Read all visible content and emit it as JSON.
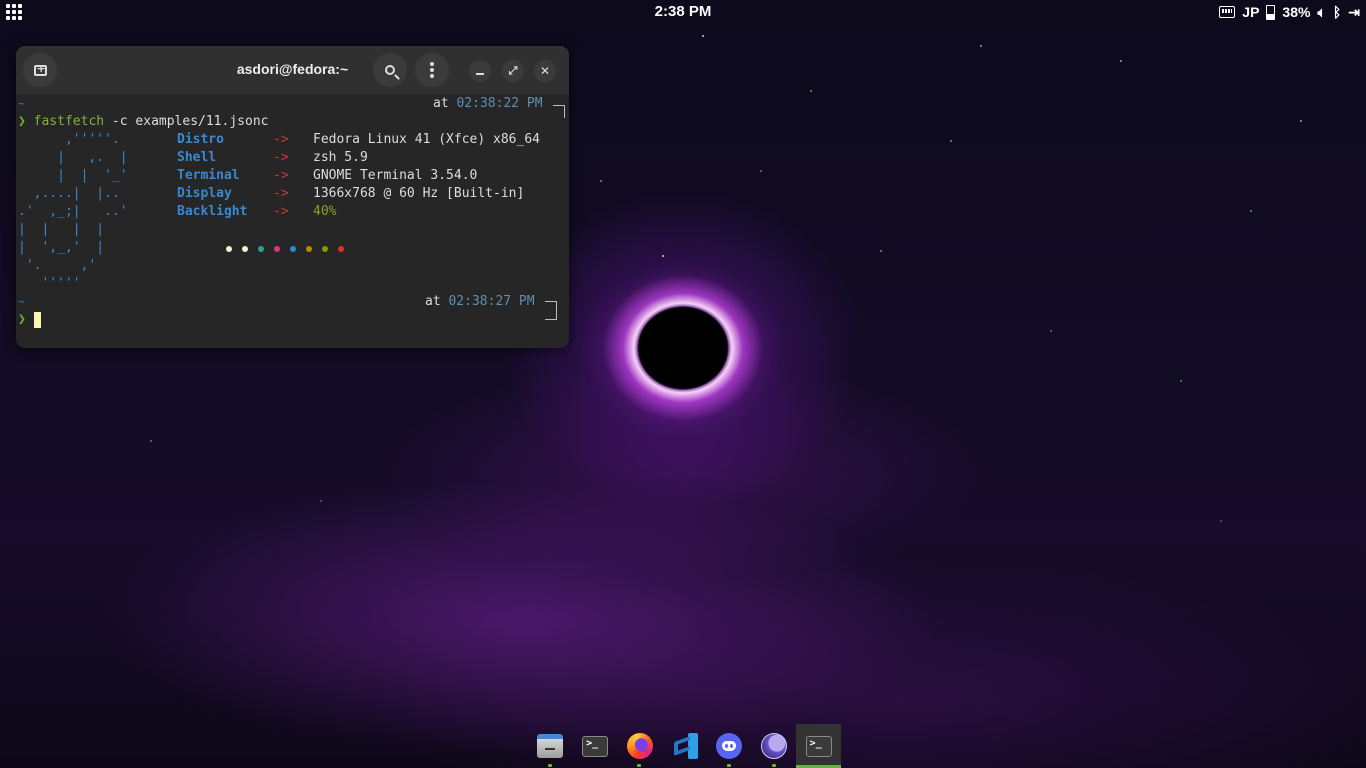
{
  "topbar": {
    "clock": "2:38 PM",
    "input_method": "JP",
    "battery_percent": "38%",
    "icons": [
      "apps-grid-icon",
      "keyboard-icon",
      "battery-icon",
      "volume-icon",
      "bluetooth-icon",
      "logout-icon"
    ]
  },
  "terminal": {
    "title": "asdori@fedora:~",
    "lines": {
      "tilde1": "~",
      "at1": "at ",
      "ts1": "02:38:22 PM",
      "prompt_char": "❯",
      "command": "fastfetch",
      "command_args": " -c examples/11.jsonc",
      "tilde2": "~",
      "at2": "at ",
      "ts2": "02:38:27 PM"
    },
    "logo": [
      "      ,'''''.",
      "     |   ,.  |",
      "     |  |  '_'",
      "  ,....|  |..",
      ".'  ,_;|   ..'",
      "|  |   |  |",
      "|  ',_,'  |",
      " '.     ,'",
      "   '''''"
    ],
    "info": [
      {
        "key": "Distro",
        "arrow": "->",
        "value": "Fedora Linux 41 (Xfce) x86_64"
      },
      {
        "key": "Shell",
        "arrow": "->",
        "value": "zsh 5.9"
      },
      {
        "key": "Terminal",
        "arrow": "->",
        "value": "GNOME Terminal 3.54.0"
      },
      {
        "key": "Display",
        "arrow": "->",
        "value": "1366x768 @ 60 Hz [Built-in]"
      },
      {
        "key": "Backlight",
        "arrow": "->",
        "value": "40%"
      }
    ],
    "color_dots": [
      "#f5f0c8",
      "#f5f0c8",
      "#2aa198",
      "#d33682",
      "#268bd2",
      "#b58900",
      "#859900",
      "#dc322f"
    ]
  },
  "dock": {
    "apps": [
      "Files",
      "Terminal",
      "Firefox",
      "Visual Studio Code",
      "Discord",
      "Moon app",
      "GNOME Terminal"
    ]
  }
}
